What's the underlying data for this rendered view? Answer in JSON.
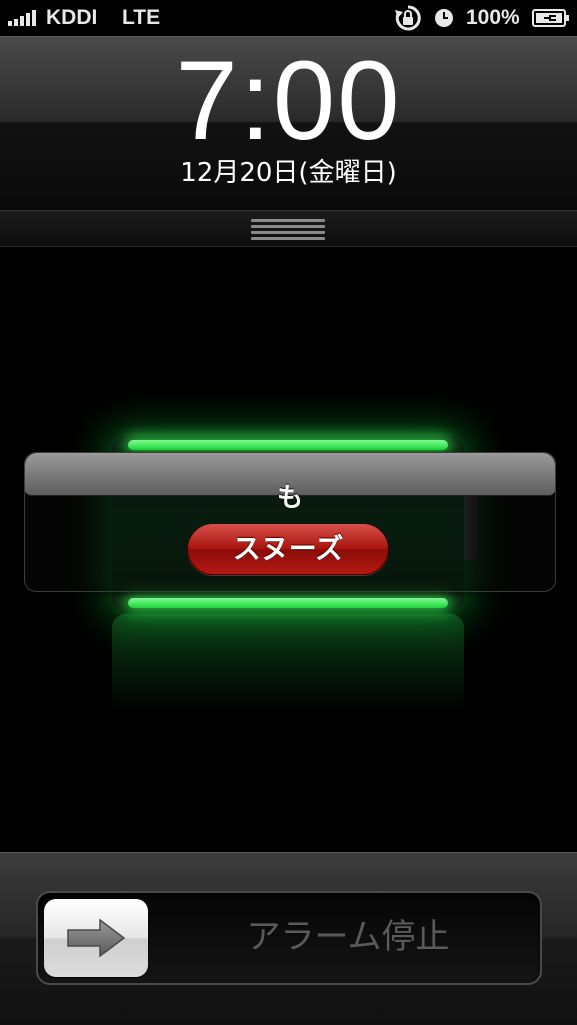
{
  "status_bar": {
    "carrier": "KDDI",
    "network": "LTE",
    "battery_percent": "100%",
    "signal_bars": 5,
    "icons": [
      "signal-icon",
      "rotation-lock-icon",
      "alarm-icon",
      "battery-charging-icon"
    ]
  },
  "lock_screen": {
    "time": "7:00",
    "date": "12月20日(金曜日)",
    "grabber_icon": "grabber-icon"
  },
  "charging": {
    "battery_level_fraction": 1.0,
    "glow_color": "#2ee85a"
  },
  "alarm_alert": {
    "message": "も",
    "snooze_label": "スヌーズ",
    "snooze_color": "#a8140e"
  },
  "slider": {
    "label": "アラーム停止",
    "knob_icon": "arrow-right-icon"
  }
}
